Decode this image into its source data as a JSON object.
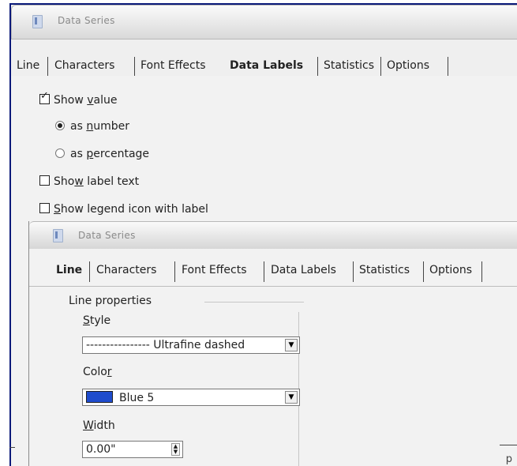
{
  "dialog": {
    "title": "Data Series",
    "tabs": [
      "Line",
      "Characters",
      "Font Effects",
      "Data Labels",
      "Statistics",
      "Options"
    ],
    "active_tab": "Data Labels"
  },
  "data_labels": {
    "show_value": {
      "pre": "Show ",
      "mnemonic": "v",
      "post": "alue",
      "checked": true
    },
    "as_number": {
      "pre": "as ",
      "mnemonic": "n",
      "post": "umber",
      "selected": true
    },
    "as_percentage": {
      "pre": "as ",
      "mnemonic": "p",
      "post": "ercentage",
      "selected": false
    },
    "show_label_text": {
      "pre": "Sho",
      "mnemonic": "w",
      "post": " label text",
      "checked": false
    },
    "show_legend_icon": {
      "pre": "",
      "mnemonic": "S",
      "post": "how legend icon with label",
      "checked": false
    }
  },
  "inner_dialog": {
    "title": "Data Series",
    "tabs": [
      "Line",
      "Characters",
      "Font Effects",
      "Data Labels",
      "Statistics",
      "Options"
    ],
    "active_tab": "Line",
    "group_label": "Line properties",
    "style_label": {
      "mnemonic": "S",
      "post": "tyle"
    },
    "style_value": "---------------- Ultrafine dashed",
    "color_label": {
      "pre": "Colo",
      "mnemonic": "r"
    },
    "color_value": "Blue 5",
    "color_hex": "#1f4ccd",
    "width_label": {
      "mnemonic": "W",
      "post": "idth"
    },
    "width_value": "0.00\"",
    "right_fragment": "p"
  }
}
